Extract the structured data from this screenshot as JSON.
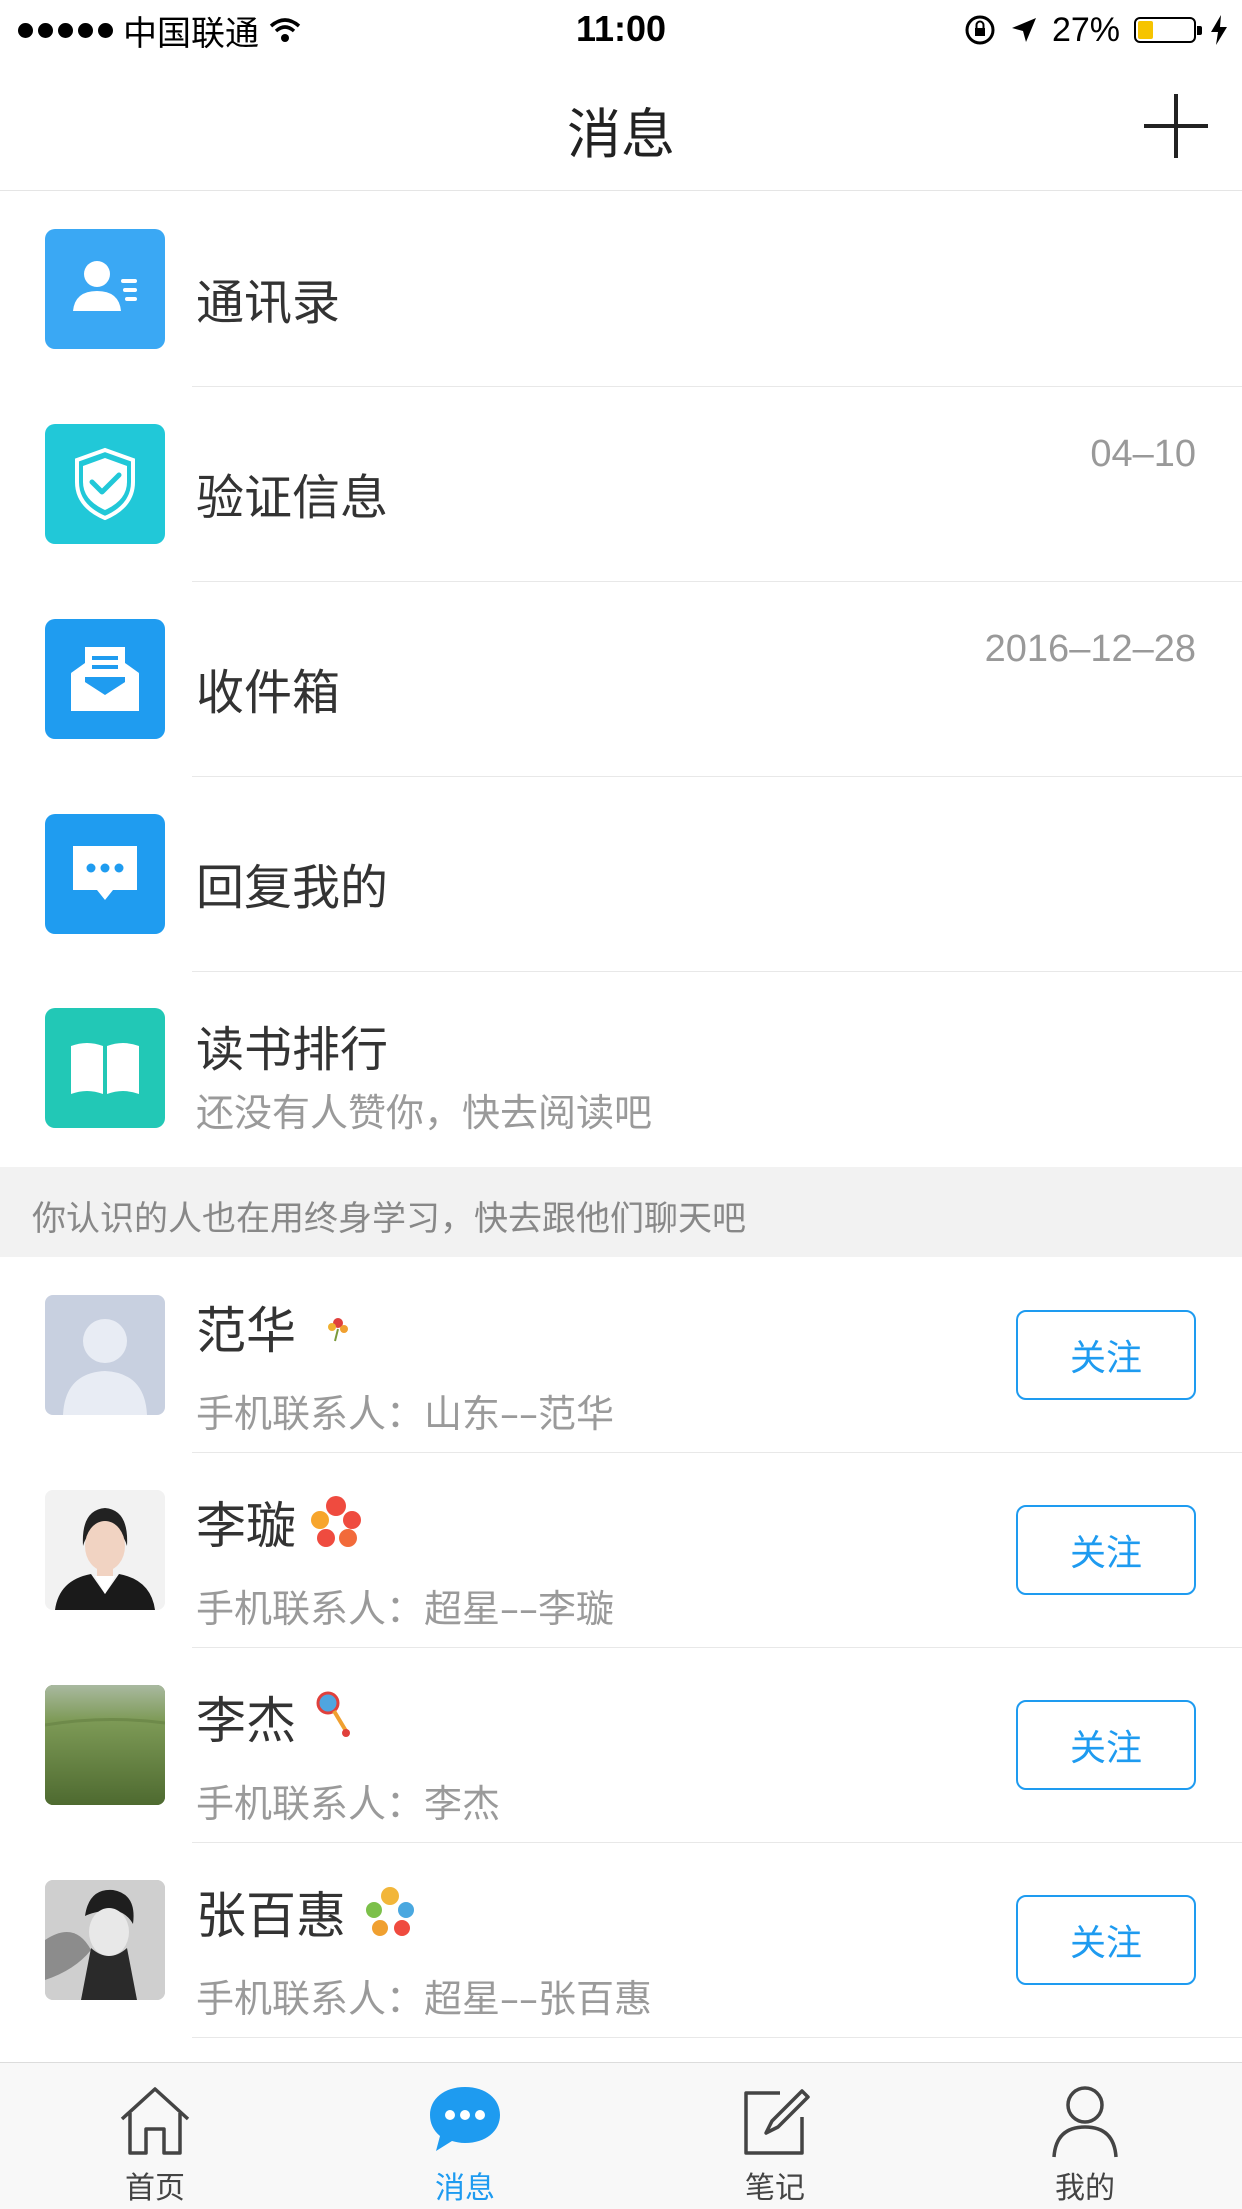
{
  "status_bar": {
    "carrier": "中国联通",
    "time": "11:00",
    "battery_text": "27%",
    "battery_level": 0.27
  },
  "header": {
    "title": "消息"
  },
  "menu_items": [
    {
      "label": "通讯录",
      "date": "",
      "subtitle": "",
      "icon": "contacts-icon",
      "color": "#3aa8f4"
    },
    {
      "label": "验证信息",
      "date": "04–10",
      "subtitle": "",
      "icon": "shield-check-icon",
      "color": "#21c8d8"
    },
    {
      "label": "收件箱",
      "date": "2016–12–28",
      "subtitle": "",
      "icon": "inbox-icon",
      "color": "#1f9cf0"
    },
    {
      "label": "回复我的",
      "date": "",
      "subtitle": "",
      "icon": "chat-bubble-icon",
      "color": "#1f9cf0"
    },
    {
      "label": "读书排行",
      "date": "",
      "subtitle": "还没有人赞你，快去阅读吧",
      "icon": "book-icon",
      "color": "#22c8b6"
    }
  ],
  "suggestion_header": "你认识的人也在用终身学习，快去跟他们聊天吧",
  "contacts": [
    {
      "name": "范华",
      "subtitle": "手机联系人：山东––范华",
      "follow_label": "关注",
      "badge": "flower-badge-small-icon"
    },
    {
      "name": "李璇",
      "subtitle": "手机联系人：超星––李璇",
      "follow_label": "关注",
      "badge": "flower-badge-red-icon"
    },
    {
      "name": "李杰",
      "subtitle": "手机联系人：李杰",
      "follow_label": "关注",
      "badge": "rattle-badge-icon"
    },
    {
      "name": "张百惠",
      "subtitle": "手机联系人：超星––张百惠",
      "follow_label": "关注",
      "badge": "flower-badge-multicolor-icon"
    }
  ],
  "tabs": [
    {
      "label": "首页",
      "icon": "home-icon",
      "active": false
    },
    {
      "label": "消息",
      "icon": "message-icon",
      "active": true
    },
    {
      "label": "笔记",
      "icon": "note-edit-icon",
      "active": false
    },
    {
      "label": "我的",
      "icon": "person-icon",
      "active": false
    }
  ],
  "colors": {
    "accent": "#1e9bf0"
  }
}
